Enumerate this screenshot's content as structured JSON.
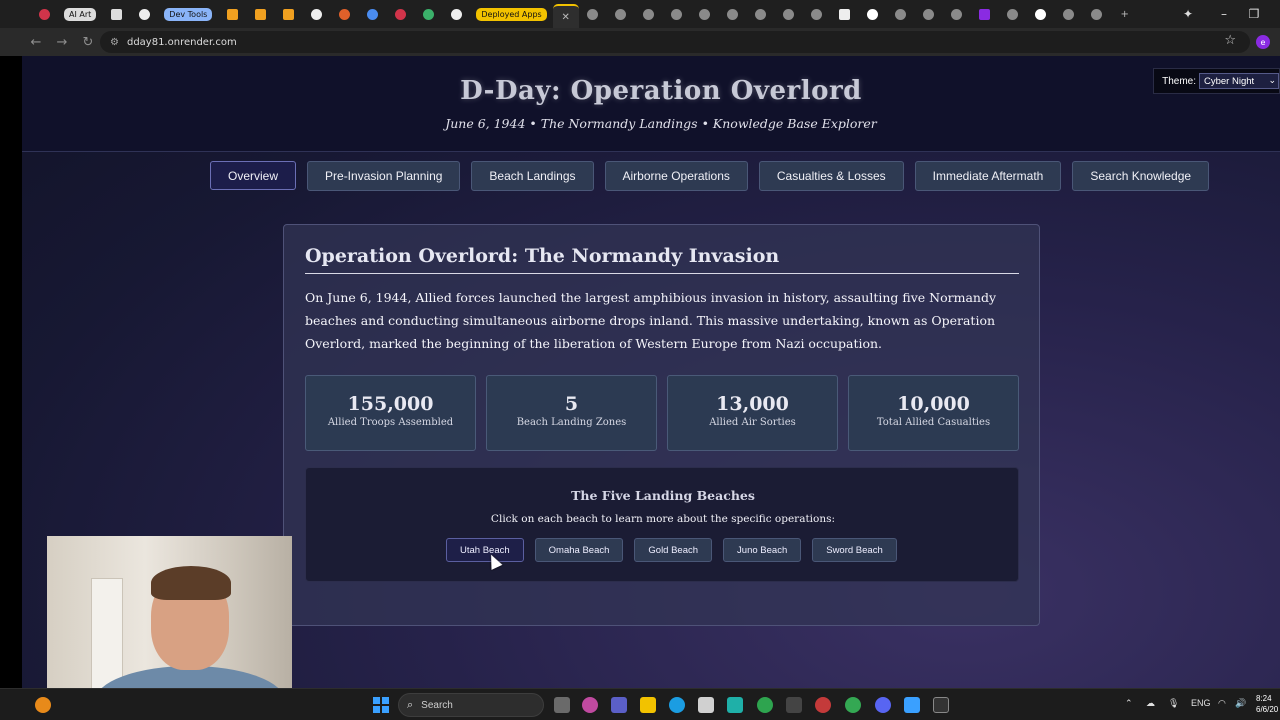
{
  "browser": {
    "tab_groups": [
      "AI Art",
      "Dev Tools",
      "Deployed Apps"
    ],
    "url": "dday81.onrender.com"
  },
  "page": {
    "title": "D-Day: Operation Overlord",
    "subtitle": "June 6, 1944 • The Normandy Landings • Knowledge Base Explorer",
    "theme": {
      "label": "Theme:",
      "selected": "Cyber Night"
    }
  },
  "nav": {
    "tabs": [
      {
        "label": "Overview",
        "active": true
      },
      {
        "label": "Pre-Invasion Planning",
        "active": false
      },
      {
        "label": "Beach Landings",
        "active": false
      },
      {
        "label": "Airborne Operations",
        "active": false
      },
      {
        "label": "Casualties & Losses",
        "active": false
      },
      {
        "label": "Immediate Aftermath",
        "active": false
      },
      {
        "label": "Search Knowledge",
        "active": false
      }
    ]
  },
  "overview": {
    "heading": "Operation Overlord: The Normandy Invasion",
    "body": "On June 6, 1944, Allied forces launched the largest amphibious invasion in history, assaulting five Normandy beaches and conducting simultaneous airborne drops inland. This massive undertaking, known as Operation Overlord, marked the beginning of the liberation of Western Europe from Nazi occupation.",
    "stats": [
      {
        "value": "155,000",
        "label": "Allied Troops Assembled"
      },
      {
        "value": "5",
        "label": "Beach Landing Zones"
      },
      {
        "value": "13,000",
        "label": "Allied Air Sorties"
      },
      {
        "value": "10,000",
        "label": "Total Allied Casualties"
      }
    ],
    "beaches": {
      "title": "The Five Landing Beaches",
      "description": "Click on each beach to learn more about the specific operations:",
      "buttons": [
        "Utah Beach",
        "Omaha Beach",
        "Gold Beach",
        "Juno Beach",
        "Sword Beach"
      ]
    }
  },
  "taskbar": {
    "search_placeholder": "Search",
    "language": "ENG",
    "time": "8:24",
    "date": "6/6/20"
  },
  "colors": {
    "accent": "#6b6fb5",
    "button_bg": "#2e3a52",
    "active_tab_bg": "#1c1d4a",
    "deployed_group": "#f2c200"
  }
}
